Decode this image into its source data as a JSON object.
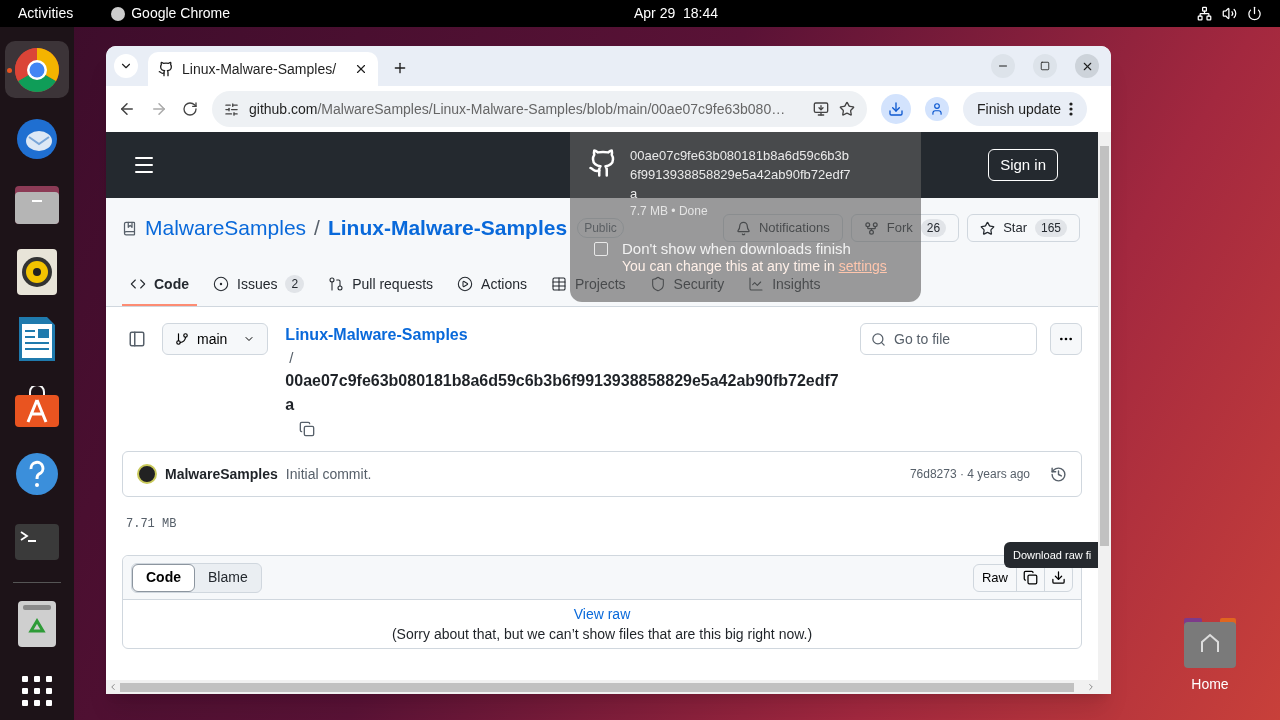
{
  "top_bar": {
    "activities": "Activities",
    "app": "Google Chrome",
    "clock": "Apr 29  18:44"
  },
  "dock": [
    {
      "kind": "chrome",
      "active": true
    },
    {
      "kind": "mail",
      "active": false
    },
    {
      "kind": "files",
      "active": false
    },
    {
      "kind": "music",
      "active": false
    },
    {
      "kind": "writer",
      "active": false
    },
    {
      "kind": "store",
      "active": false
    },
    {
      "kind": "help",
      "active": false
    },
    {
      "kind": "terminal",
      "active": false
    },
    {
      "kind": "trash",
      "active": false
    },
    {
      "kind": "apps",
      "active": false
    }
  ],
  "browser": {
    "tab_title": "Linux-Malware-Samples/",
    "url_host": "github.com",
    "url_path": "/MalwareSamples/Linux-Malware-Samples/blob/main/00ae07c9fe63b080…",
    "update_button": "Finish update"
  },
  "github": {
    "sign_in": "Sign in",
    "owner": "MalwareSamples",
    "separator": "/",
    "repo": "Linux-Malware-Samples",
    "visibility": "Public",
    "notifications": "Notifications",
    "fork": "Fork",
    "fork_count": "26",
    "star": "Star",
    "star_count": "165",
    "nav": [
      {
        "label": "Code",
        "selected": true,
        "kind": "code"
      },
      {
        "label": "Issues",
        "count": "2",
        "selected": false,
        "kind": "issues"
      },
      {
        "label": "Pull requests",
        "selected": false,
        "kind": "pulls"
      },
      {
        "label": "Actions",
        "selected": false,
        "kind": "actions"
      },
      {
        "label": "Projects",
        "selected": false,
        "kind": "projects"
      },
      {
        "label": "Security",
        "selected": false,
        "kind": "security"
      },
      {
        "label": "Insights",
        "selected": false,
        "kind": "insights"
      }
    ],
    "branch": "main",
    "breadcrumb_repo": "Linux-Malware-Samples",
    "breadcrumb_sep": "/",
    "filename": "00ae07c9fe63b080181b8a6d59c6b3b6f9913938858829e5a42ab90fb72edf7a",
    "go_to_file": "Go to file",
    "commit": {
      "author": "MalwareSamples",
      "message": "Initial commit.",
      "meta": "76d8273 · 4 years ago"
    },
    "file_size": "7.71 MB",
    "view_tabs": [
      {
        "label": "Code",
        "selected": true
      },
      {
        "label": "Blame",
        "selected": false
      }
    ],
    "raw": "Raw",
    "tooltip": "Download raw fi",
    "view_raw": "View raw",
    "notice": "(Sorry about that, but we can’t show files that are this big right now.)"
  },
  "download_popup": {
    "filename": "00ae07c9fe63b080181b8a6d59c6b3b6f9913938858829e5a42ab90fb72edf7a",
    "status": "7.7 MB • Done",
    "checkbox_label": "Don't show when downloads finish",
    "checked": false,
    "hint": "You can change this at any time in ",
    "hint_link": "settings"
  },
  "desktop_icon": {
    "label": "Home"
  }
}
